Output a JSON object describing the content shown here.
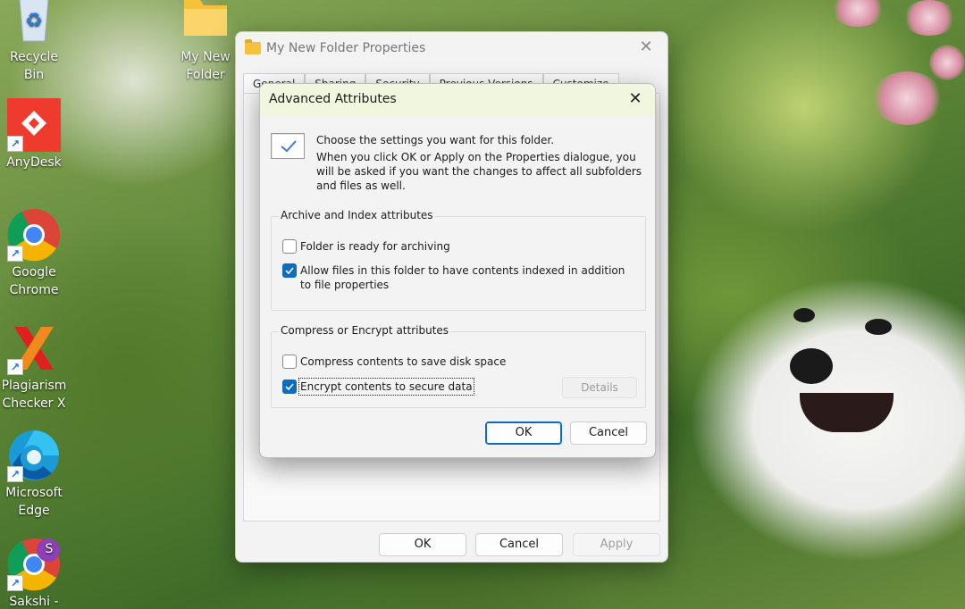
{
  "desktop": {
    "icons": [
      {
        "label": "Recycle Bin"
      },
      {
        "label": "My New Folder"
      },
      {
        "label": "AnyDesk"
      },
      {
        "label": "Google Chrome"
      },
      {
        "label": "Plagiarism Checker X"
      },
      {
        "label": "Microsoft Edge"
      },
      {
        "label": "Sakshi -"
      }
    ],
    "profile_badge": "S"
  },
  "properties_window": {
    "title": "My New Folder Properties",
    "tabs": [
      "General",
      "Sharing",
      "Security",
      "Previous Versions",
      "Customize"
    ],
    "buttons": {
      "ok": "OK",
      "cancel": "Cancel",
      "apply": "Apply"
    }
  },
  "advanced_dialog": {
    "title": "Advanced Attributes",
    "intro_heading": "Choose the settings you want for this folder.",
    "intro_body": "When you click OK or Apply on the Properties dialogue, you will be asked if you want the changes to affect all subfolders and files as well.",
    "archive_group": {
      "label": "Archive and Index attributes",
      "options": [
        {
          "label": "Folder is ready for archiving",
          "checked": false
        },
        {
          "label": "Allow files in this folder to have contents indexed in addition to file properties",
          "checked": true
        }
      ]
    },
    "compress_group": {
      "label": "Compress or Encrypt attributes",
      "options": [
        {
          "label": "Compress contents to save disk space",
          "checked": false
        },
        {
          "label": "Encrypt contents to secure data",
          "checked": true
        }
      ],
      "details_label": "Details"
    },
    "buttons": {
      "ok": "OK",
      "cancel": "Cancel"
    }
  },
  "colors": {
    "accent": "#0f6cbd",
    "dialog_titlebar": "#f1f6df",
    "folder_yellow": "#f5c33b"
  }
}
